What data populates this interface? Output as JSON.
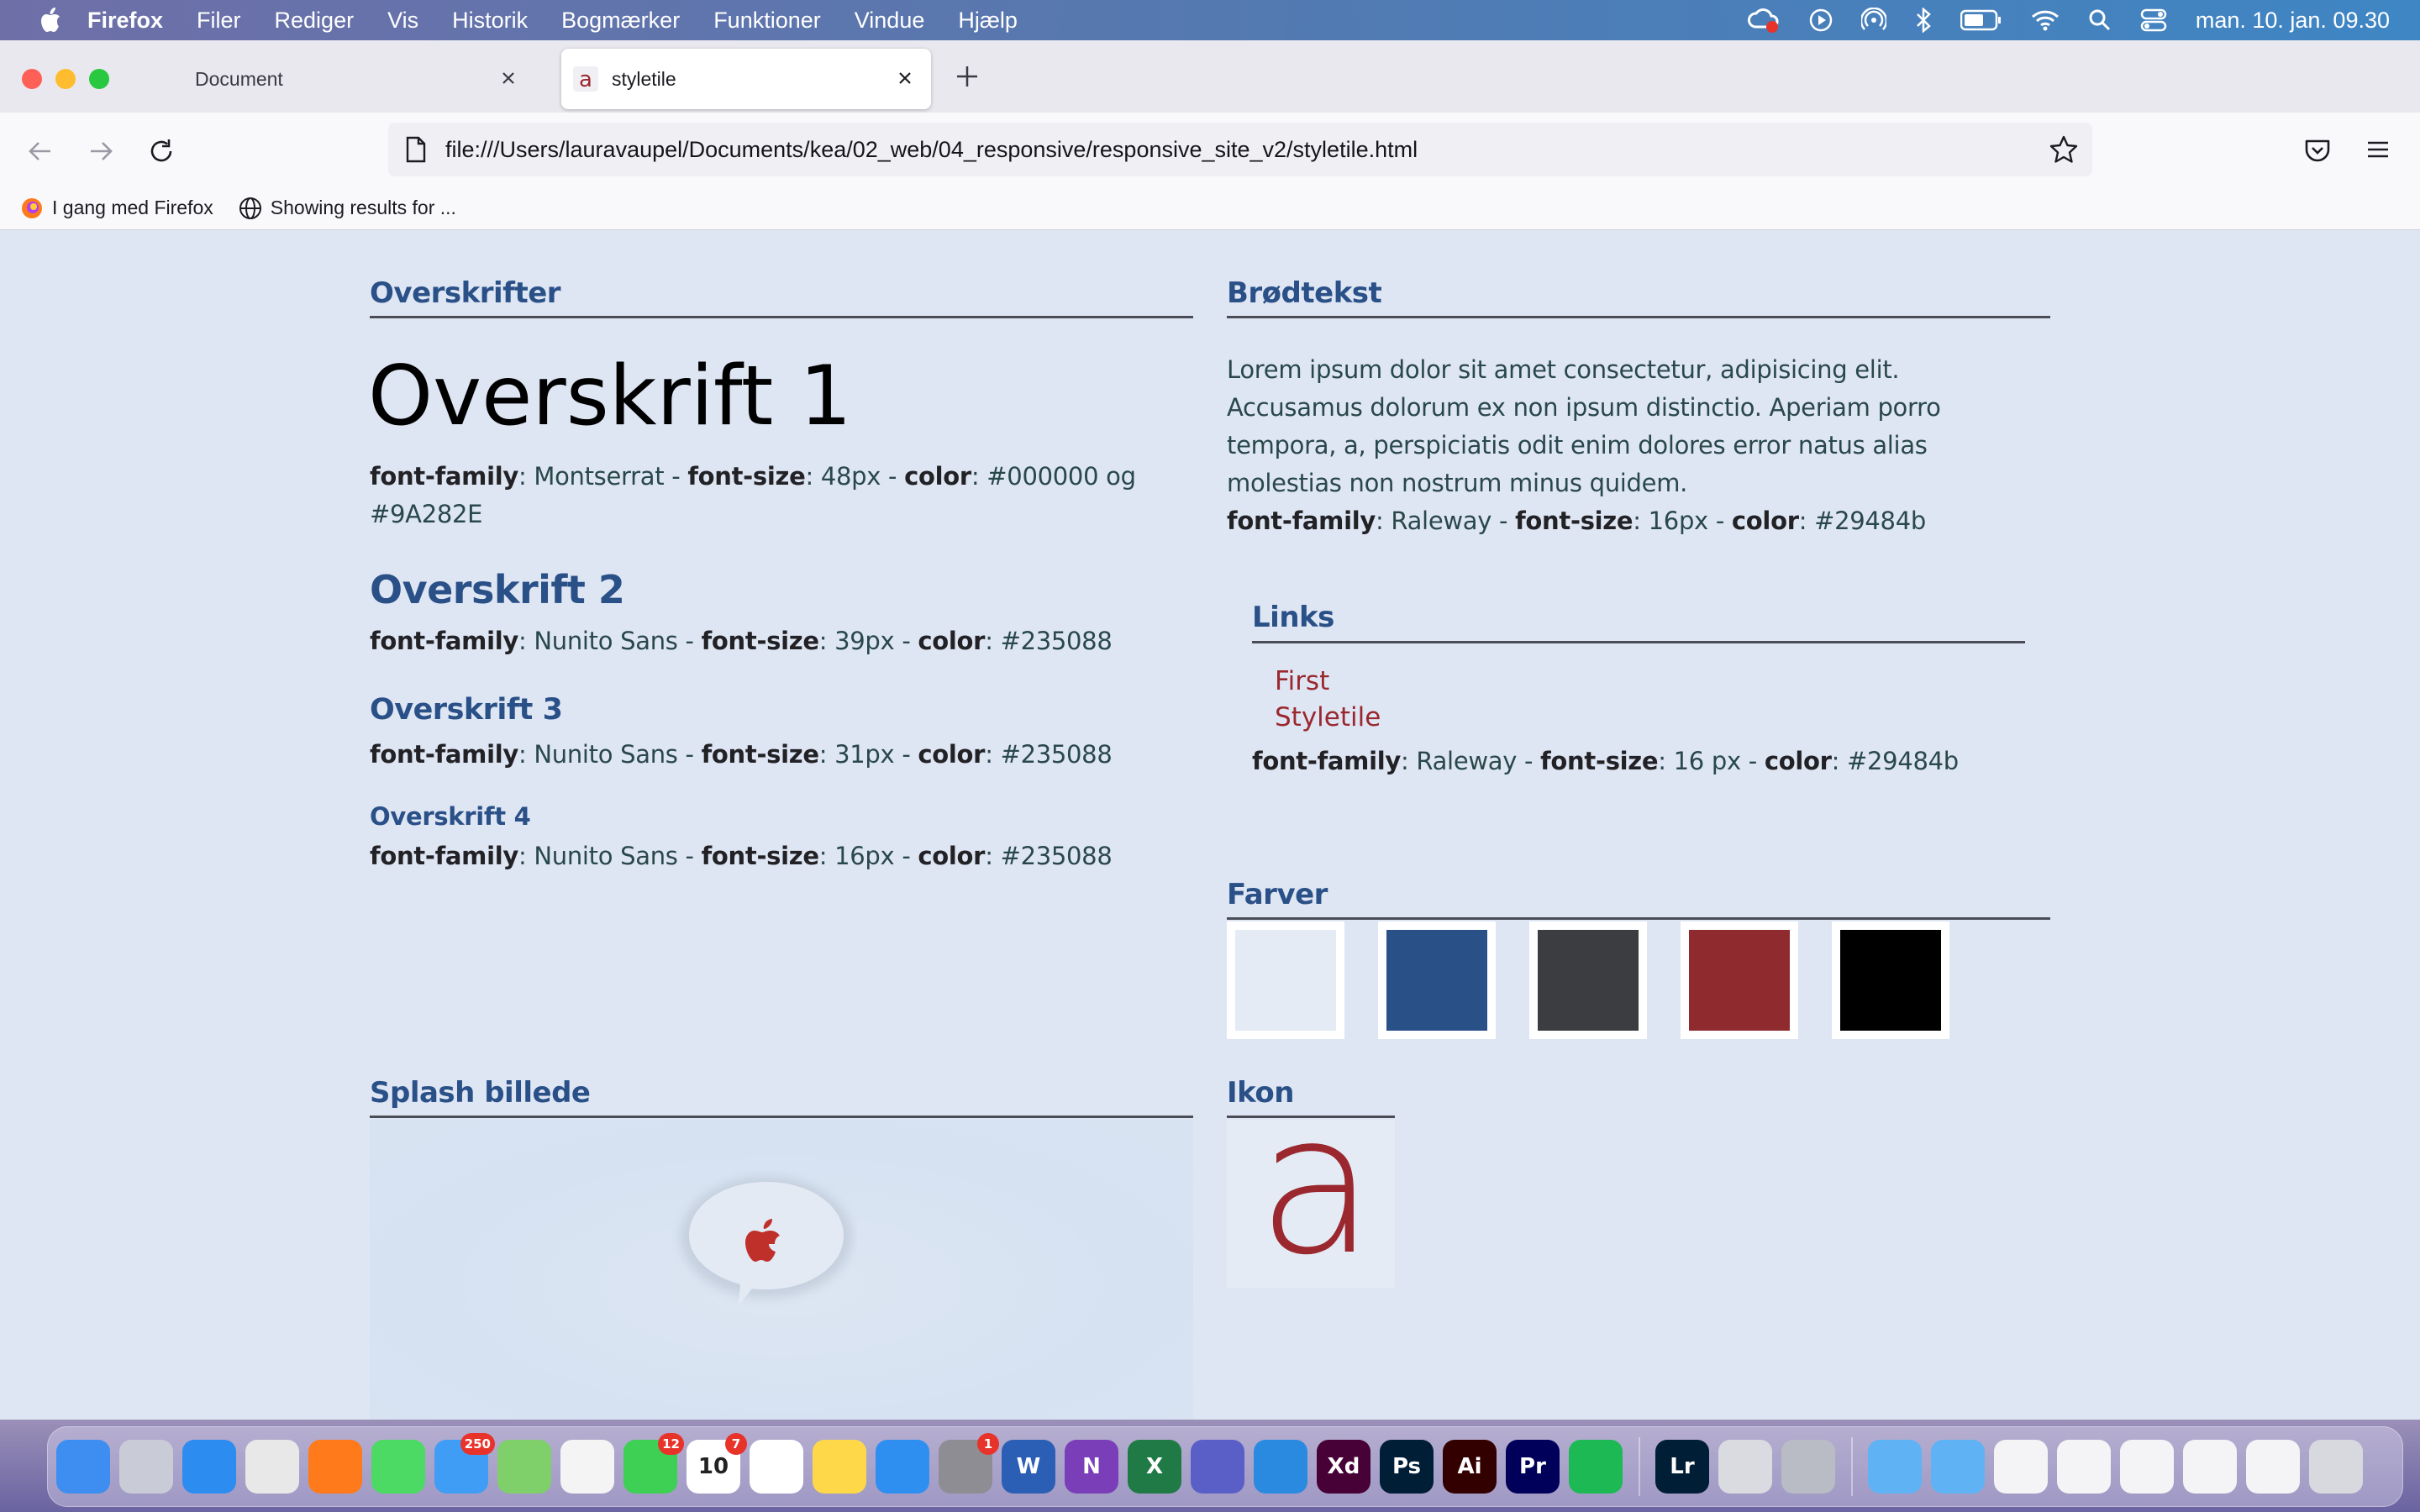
{
  "menubar": {
    "app": "Firefox",
    "items": [
      "Filer",
      "Rediger",
      "Vis",
      "Historik",
      "Bogmærker",
      "Funktioner",
      "Vindue",
      "Hjælp"
    ],
    "clock": "man. 10. jan.  09.30",
    "icons": [
      "creative-cloud-icon",
      "play-icon",
      "airdrop-icon",
      "bluetooth-icon",
      "battery-icon",
      "wifi-icon",
      "spotlight-icon",
      "control-center-icon"
    ]
  },
  "tabs": [
    {
      "title": "Document",
      "active": false
    },
    {
      "title": "styletile",
      "active": true
    }
  ],
  "url": "file:///Users/lauravaupel/Documents/kea/02_web/04_responsive/responsive_site_v2/styletile.html",
  "bookmarks": [
    {
      "label": "I gang med Firefox",
      "icon": "firefox-icon"
    },
    {
      "label": "Showing results for ...",
      "icon": "globe-icon"
    }
  ],
  "page": {
    "headings_section": "Overskrifter",
    "h1": {
      "text": "Overskrift 1",
      "spec_label": "font-family",
      "spec1": ": Montserrat - ",
      "size_label": "font-size",
      "spec2": ": 48px - ",
      "color_label": "color",
      "spec3": ": #000000 og",
      "spec4": "#9A282E"
    },
    "h2": {
      "text": "Overskrift 2",
      "spec_label": "font-family",
      "spec1": ": Nunito Sans - ",
      "size_label": "font-size",
      "spec2": ": 39px - ",
      "color_label": "color",
      "spec3": ": #235088"
    },
    "h3": {
      "text": "Overskrift 3",
      "spec_label": "font-family",
      "spec1": ": Nunito Sans - ",
      "size_label": "font-size",
      "spec2": ": 31px - ",
      "color_label": "color",
      "spec3": ": #235088"
    },
    "h4": {
      "text": "Overskrift 4",
      "spec_label": "font-family",
      "spec1": ": Nunito Sans - ",
      "size_label": "font-size",
      "spec2": ": 16px - ",
      "color_label": "color",
      "spec3": ": #235088"
    },
    "body_section": "Brødtekst",
    "body_lines": [
      "Lorem ipsum dolor sit amet consectetur, adipisicing elit.",
      "Accusamus dolorum ex non ipsum distinctio. Aperiam porro",
      "tempora, a, perspiciatis odit enim dolores error natus alias",
      "molestias non nostrum minus quidem."
    ],
    "body_spec": {
      "spec_label": "font-family",
      "spec1": ": Raleway - ",
      "size_label": "font-size",
      "spec2": ": 16px - ",
      "color_label": "color",
      "spec3": ": #29484b"
    },
    "links_section": "Links",
    "links": [
      "First",
      "Styletile"
    ],
    "links_spec": {
      "spec_label": "font-family",
      "spec1": ": Raleway - ",
      "size_label": "font-size",
      "spec2": ": 16 px - ",
      "color_label": "color",
      "spec3": ": #29484b"
    },
    "colors_section": "Farver",
    "swatches": [
      "#e4ebf5",
      "#2a5088",
      "#3c3d40",
      "#8f2b2e",
      "#000000"
    ],
    "splash_section": "Splash billede",
    "icon_section": "Ikon",
    "icon_glyph": "a"
  },
  "dock": {
    "apps": [
      {
        "name": "finder",
        "color": "#3d8ef0",
        "label": ""
      },
      {
        "name": "launchpad",
        "color": "#c9ccd6",
        "label": ""
      },
      {
        "name": "safari",
        "color": "#2d8cf0",
        "label": ""
      },
      {
        "name": "chrome",
        "color": "#e8e8e8",
        "label": ""
      },
      {
        "name": "firefox",
        "color": "#ff7a1a",
        "label": ""
      },
      {
        "name": "messages",
        "color": "#4cd964",
        "label": ""
      },
      {
        "name": "mail",
        "color": "#3f9df5",
        "label": "",
        "badge": "250"
      },
      {
        "name": "maps",
        "color": "#7fcf6a",
        "label": ""
      },
      {
        "name": "photos",
        "color": "#f4f4f4",
        "label": ""
      },
      {
        "name": "facetime",
        "color": "#3ecf55",
        "label": "",
        "badge": "12"
      },
      {
        "name": "calendar",
        "color": "#ffffff",
        "label": "10",
        "badge": "7"
      },
      {
        "name": "reminders",
        "color": "#ffffff",
        "label": ""
      },
      {
        "name": "notes",
        "color": "#ffd84a",
        "label": ""
      },
      {
        "name": "app-store",
        "color": "#2f8ff0",
        "label": ""
      },
      {
        "name": "system-preferences",
        "color": "#8d8d93",
        "label": "",
        "badge": "1"
      },
      {
        "name": "word",
        "color": "#2b5fb5",
        "label": "W"
      },
      {
        "name": "onenote",
        "color": "#7a3fb8",
        "label": "N"
      },
      {
        "name": "excel",
        "color": "#1f7a45",
        "label": "X"
      },
      {
        "name": "teams",
        "color": "#5a5fc8",
        "label": ""
      },
      {
        "name": "vscode",
        "color": "#2a8ae0",
        "label": ""
      },
      {
        "name": "adobe-xd",
        "color": "#470137",
        "label": "Xd"
      },
      {
        "name": "photoshop",
        "color": "#001e36",
        "label": "Ps"
      },
      {
        "name": "illustrator",
        "color": "#330000",
        "label": "Ai"
      },
      {
        "name": "premiere",
        "color": "#00005b",
        "label": "Pr"
      },
      {
        "name": "spotify",
        "color": "#1db954",
        "label": ""
      }
    ],
    "apps2": [
      {
        "name": "lightroom",
        "color": "#001e36",
        "label": "Lr"
      },
      {
        "name": "preview",
        "color": "#d9dbe0",
        "label": ""
      },
      {
        "name": "font-book",
        "color": "#b9bcc4",
        "label": ""
      }
    ]
  }
}
